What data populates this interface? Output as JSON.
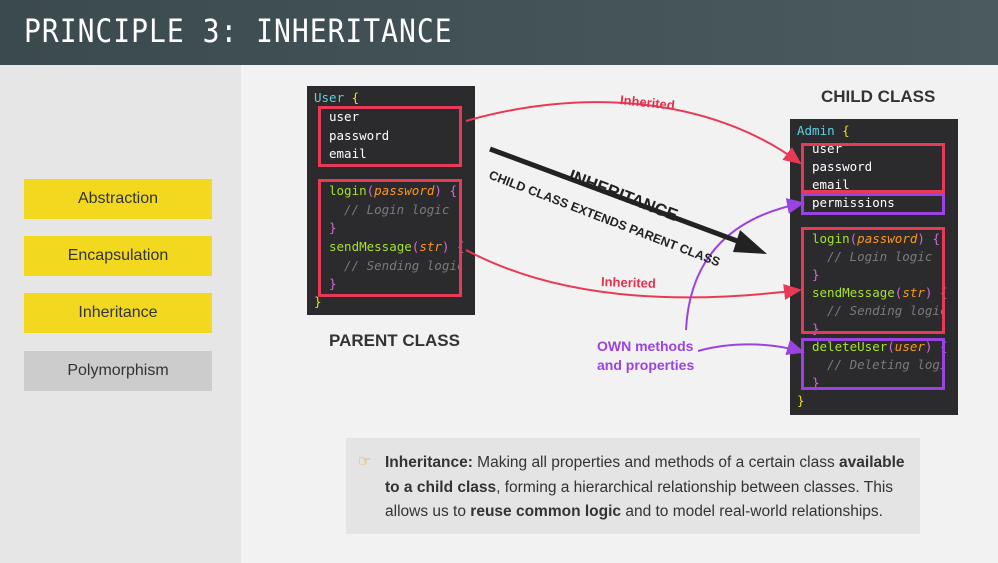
{
  "header": {
    "title": "PRINCIPLE 3: INHERITANCE"
  },
  "sidebar": {
    "items": [
      {
        "label": "Abstraction",
        "active": true
      },
      {
        "label": "Encapsulation",
        "active": true
      },
      {
        "label": "Inheritance",
        "active": true
      },
      {
        "label": "Polymorphism",
        "active": false
      }
    ]
  },
  "parent": {
    "class_name": "User",
    "open_brace": "{",
    "close_brace": "}",
    "props": [
      "user",
      "password",
      "email"
    ],
    "methods": [
      {
        "name": "login",
        "param": "password",
        "comment": "// Login logic"
      },
      {
        "name": "sendMessage",
        "param": "str",
        "comment": "// Sending logic"
      }
    ],
    "label": "PARENT CLASS"
  },
  "child": {
    "class_name": "Admin",
    "open_brace": "{",
    "close_brace": "}",
    "props": [
      "user",
      "password",
      "email"
    ],
    "own_prop": "permissions",
    "methods": [
      {
        "name": "login",
        "param": "password",
        "comment": "// Login logic"
      },
      {
        "name": "sendMessage",
        "param": "str",
        "comment": "// Sending logic"
      }
    ],
    "own_method": {
      "name": "deleteUser",
      "param": "user",
      "comment": "// Deleting logic"
    },
    "label": "CHILD CLASS"
  },
  "arrows": {
    "inherited_label": "Inherited",
    "inheritance_title": "INHERITANCE",
    "inheritance_subtitle": "CHILD CLASS EXTENDS PARENT CLASS",
    "own_line1": "OWN methods",
    "own_line2": "and properties"
  },
  "note": {
    "icon": "pointing-hand-icon",
    "term": "Inheritance:",
    "t1": " Making all properties and methods of a certain class ",
    "b1": "available to a child class",
    "t2": ", forming a hierarchical relationship between classes. This allows us to ",
    "b2": "reuse common logic",
    "t3": " and to model real-world relationships."
  },
  "colors": {
    "header": "#3b4a4e",
    "accent_yellow": "#f2d91f",
    "inherited_red": "#e83a57",
    "own_purple": "#9b43e0",
    "code_bg": "#2b2a2c"
  }
}
